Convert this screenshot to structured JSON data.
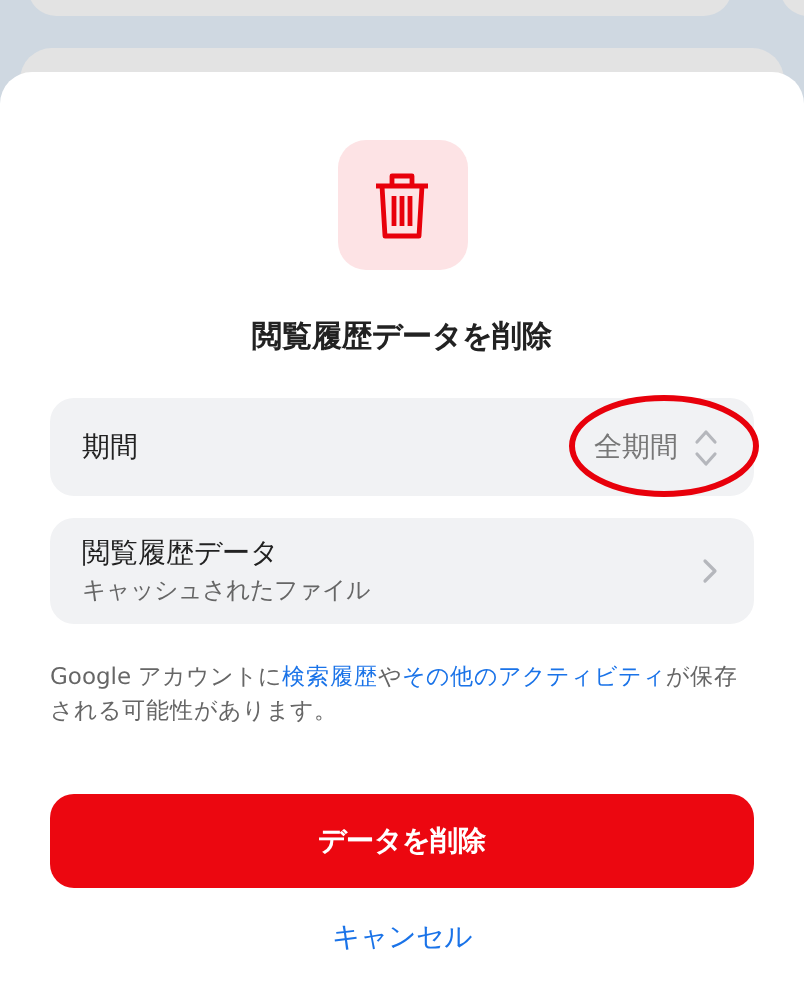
{
  "title": "閲覧履歴データを削除",
  "period_row": {
    "label": "期間",
    "value": "全期間",
    "circled": true
  },
  "data_row": {
    "title": "閲覧履歴データ",
    "subtitle": "キャッシュされたファイル"
  },
  "note": [
    {
      "kind": "text",
      "text": "Google アカウントに"
    },
    {
      "kind": "link",
      "text": "検索履歴"
    },
    {
      "kind": "text",
      "text": "や"
    },
    {
      "kind": "link",
      "text": "その他のアクティビティ"
    },
    {
      "kind": "text",
      "text": "が保存される可能性があります。"
    }
  ],
  "buttons": [
    {
      "kind": "primary",
      "label": "データを削除"
    },
    {
      "kind": "text",
      "label": "キャンセル"
    }
  ]
}
